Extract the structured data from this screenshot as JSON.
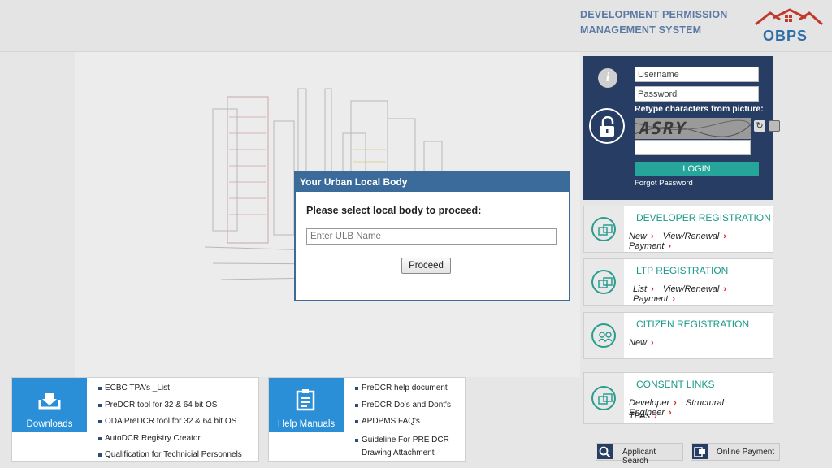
{
  "header": {
    "title_line1": "DEVELOPMENT PERMISSION",
    "title_line2": "MANAGEMENT SYSTEM",
    "logo_text": "OBPS",
    "logo_icon": "house-roof-logo-icon"
  },
  "modal": {
    "title": "Your Urban Local Body",
    "prompt": "Please select local body to proceed:",
    "input_placeholder": "Enter ULB Name",
    "proceed_label": "Proceed"
  },
  "login": {
    "username_placeholder": "Username",
    "password_placeholder": "Password",
    "captcha_label": "Retype characters from picture:",
    "captcha_text": "ASRY",
    "login_label": "LOGIN",
    "forgot_label": "Forgot Password",
    "icons": [
      "info-icon",
      "lock-icon",
      "refresh-icon",
      "audio-icon"
    ]
  },
  "registrations": {
    "developer": {
      "title": "DEVELOPER REGISTRATION",
      "links": [
        "New",
        "View/Renewal",
        "Payment"
      ]
    },
    "ltp": {
      "title": "LTP REGISTRATION",
      "links": [
        "List",
        "View/Renewal",
        "Payment"
      ]
    },
    "citizen": {
      "title": "CITIZEN REGISTRATION",
      "links": [
        "New"
      ]
    },
    "consent": {
      "title": "CONSENT LINKS",
      "links": [
        "Developer",
        "Structural Engineer",
        "TPAs"
      ]
    }
  },
  "downloads": {
    "label": "Downloads",
    "items": [
      "ECBC TPA's _List",
      "PreDCR tool for 32 & 64 bit OS",
      "ODA PreDCR tool for 32 & 64 bit OS",
      "AutoDCR Registry Creator",
      "Qualification for Technicial Personnels"
    ]
  },
  "manuals": {
    "label": "Help Manuals",
    "items": [
      "PreDCR help document",
      "PreDCR Do's and Dont's",
      "APDPMS FAQ's",
      "Guideline For PRE DCR Drawing Attachment"
    ]
  },
  "quick": {
    "applicant_search": "Applicant Search",
    "online_payment": "Online Payment"
  },
  "colors": {
    "login_panel": "#273d63",
    "modal_header": "#3b6b9a",
    "accent_teal": "#1a9a8a",
    "login_button": "#26a69a",
    "tile_blue": "#2a8fd6",
    "link_arrow": "#d82a2a"
  }
}
